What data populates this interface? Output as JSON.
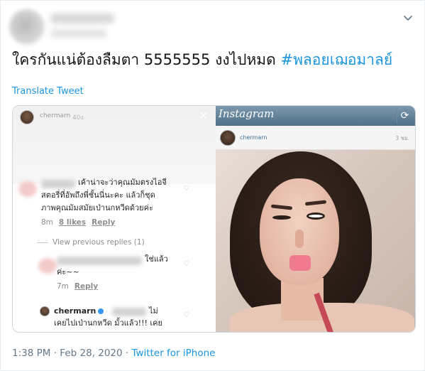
{
  "tweet": {
    "text_main": "ใครกันแน่ต้องลืมตา 5555555 งงไปหมด ",
    "hashtag": "#พลอยเฌอมาลย์",
    "translate_label": "Translate Tweet",
    "time": "1:38 PM",
    "separator": "·",
    "date": "Feb 28, 2020",
    "via": "Twitter for iPhone"
  },
  "screenshot_left": {
    "username": "chermarn",
    "time": "40ง",
    "comment1": {
      "lines": [
        "เค้าน่าจะว่าคุณมัมตรงไอจี",
        "สตอรี่ที่อัพถึงพี่ชั้นนี่นะคะ แล้วก็ชุด",
        "ภาพคุณมัมสมัยเป่านกหวีดด้วยค่ะ"
      ],
      "age": "8m",
      "likes": "8 likes",
      "reply": "Reply"
    },
    "view_previous": "View previous replies (1)",
    "comment2": {
      "lines": [
        "ใช่แล้ว",
        "ค่ะ~~"
      ],
      "age": "7m",
      "reply": "Reply"
    },
    "comment3": {
      "username": "chermarn",
      "lines": [
        "ไม่",
        "เคยไปเป่านกหวีด มั้วแล้ว!!! เคย"
      ]
    }
  },
  "screenshot_right": {
    "app_name": "Instagram",
    "username": "chermarn",
    "time": "3 ชม."
  },
  "colors": {
    "link": "#1b95e0",
    "meta": "#657786",
    "ig_bar": "#5b7b93"
  }
}
